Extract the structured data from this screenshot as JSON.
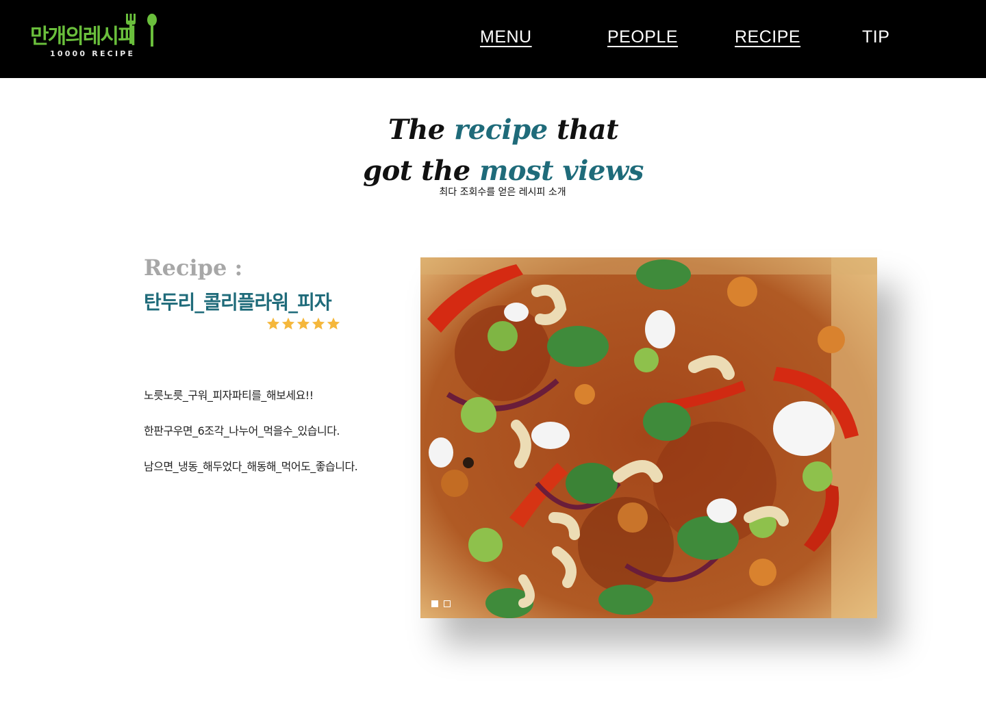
{
  "header": {
    "logo_text": "만개의레시피",
    "logo_sub": "10000 RECIPE",
    "nav": [
      {
        "label": "MENU"
      },
      {
        "label": "PEOPLE"
      },
      {
        "label": "RECIPE"
      },
      {
        "label": "TIP"
      }
    ]
  },
  "hero": {
    "line1_part1": "The",
    "line1_accent": "recipe",
    "line1_part2": "that",
    "line2_part1": "got the",
    "line2_accent": "most views",
    "subtitle": "최다 조회수를 얻은 레시피 소개"
  },
  "recipe": {
    "prefix": "Recipe :",
    "name": "탄두리_콜리플라워_피자",
    "rating_stars": 5,
    "description": [
      "노릇노릇_구워_피자파티를_해보세요!!",
      "한판구우면_6조각_나누어_먹을수_있습니다.",
      "남으면_냉동_해두었다_해동해_먹어도_좋습니다."
    ],
    "star_color": "#f5b73b",
    "accent_color": "#1f6b7a"
  },
  "carousel": {
    "image_icon": "pizza-photo",
    "slides": 2,
    "active_slide": 1
  }
}
